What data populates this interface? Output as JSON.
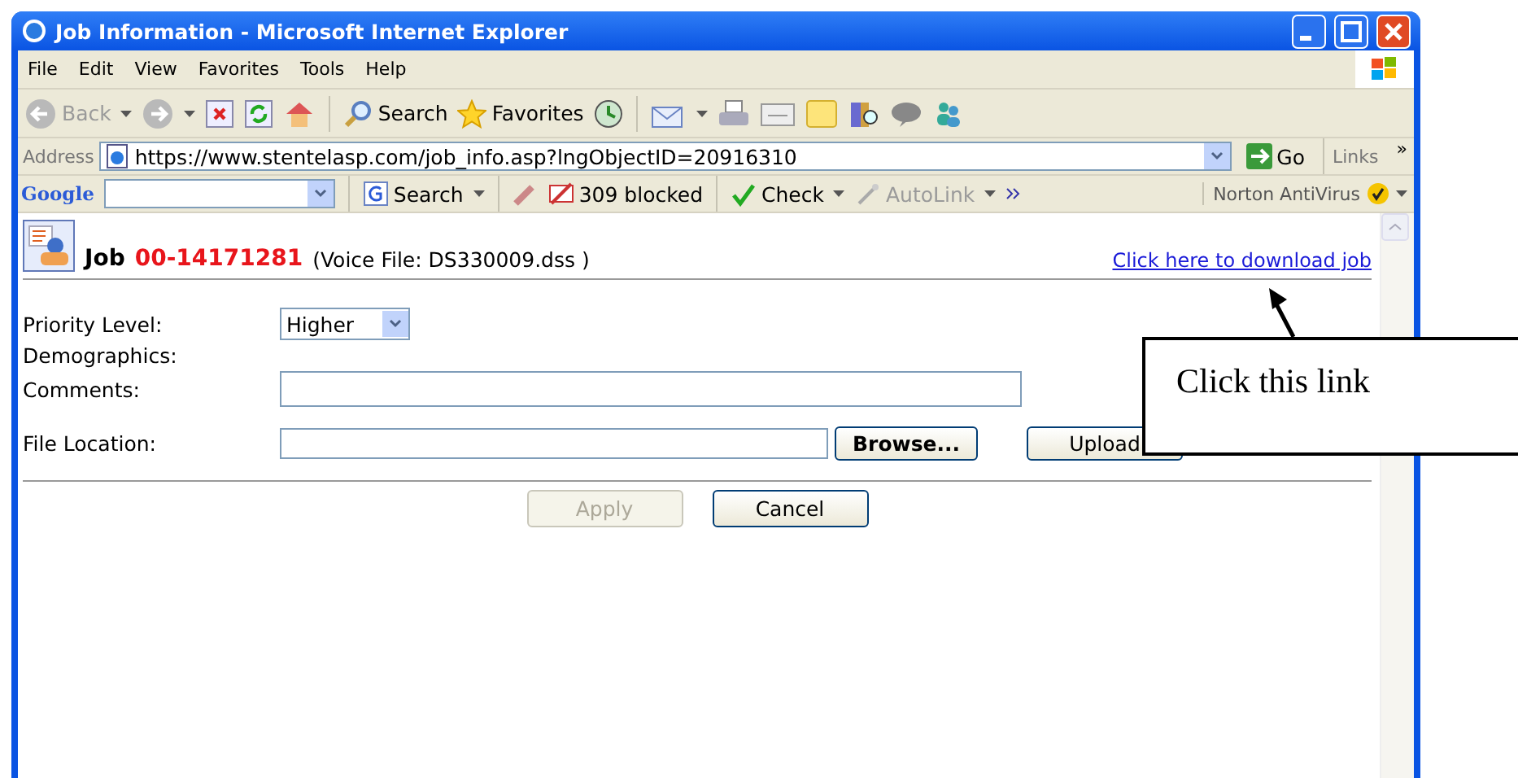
{
  "window": {
    "title": "Job Information - Microsoft Internet Explorer"
  },
  "menu": [
    "File",
    "Edit",
    "View",
    "Favorites",
    "Tools",
    "Help"
  ],
  "toolbar": {
    "back": "Back",
    "search": "Search",
    "favorites": "Favorites"
  },
  "address_bar": {
    "label": "Address",
    "url": "https://www.stentelasp.com/job_info.asp?lngObjectID=20916310",
    "go": "Go",
    "links": "Links",
    "more": "»"
  },
  "google_bar": {
    "logo": "Google",
    "items": [
      {
        "kind": "search",
        "label": "Search",
        "disabled": false
      },
      {
        "kind": "blocked",
        "label": "309 blocked",
        "disabled": false
      },
      {
        "kind": "check",
        "label": "Check",
        "disabled": false
      },
      {
        "kind": "autolink",
        "label": "AutoLink",
        "disabled": true
      }
    ],
    "norton": "Norton AntiVirus"
  },
  "page": {
    "job_label": "Job",
    "job_number": "00-14171281",
    "voice_file": "(Voice File: DS330009.dss )",
    "download_link": "Click here to download job",
    "fields": [
      {
        "kind": "select",
        "label": "Priority Level:",
        "value": "Higher"
      },
      {
        "kind": "none",
        "label": "Demographics:"
      },
      {
        "kind": "text",
        "label": "Comments:"
      },
      {
        "kind": "file",
        "label": "File Location:",
        "browse": "Browse...",
        "upload": "Upload"
      }
    ],
    "buttons": [
      {
        "label": "Apply",
        "disabled": true
      },
      {
        "label": "Cancel",
        "disabled": false
      }
    ]
  },
  "callout": {
    "text": "Click this link"
  }
}
